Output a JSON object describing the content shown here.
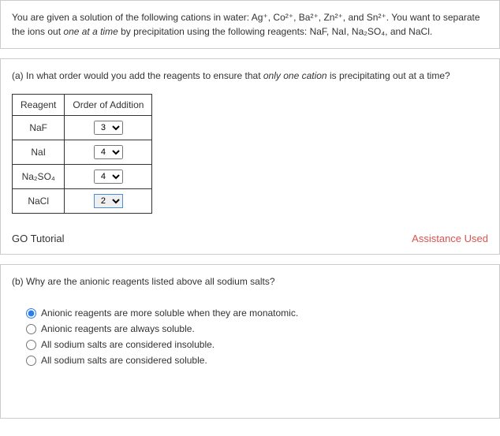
{
  "intro": {
    "prefix": "You are given a solution of the following cations in water: Ag⁺, Co²⁺, Ba²⁺, Zn²⁺, and Sn²⁺. You want to separate the ions out ",
    "italic1": "one at a time",
    "mid": " by precipitation using the following reagents: NaF, NaI, Na₂SO₄, and NaCl."
  },
  "partA": {
    "question_prefix": "(a) In what order would you add the reagents to ensure that ",
    "question_italic": "only one cation",
    "question_suffix": " is precipitating out at a time?",
    "headers": {
      "col1": "Reagent",
      "col2": "Order of Addition"
    },
    "rows": [
      {
        "reagent": "NaF",
        "value": "3"
      },
      {
        "reagent": "NaI",
        "value": "4"
      },
      {
        "reagent": "Na₂SO₄",
        "value": "4"
      },
      {
        "reagent": "NaCl",
        "value": "2"
      }
    ],
    "go_tutorial": "GO Tutorial",
    "assistance": "Assistance Used"
  },
  "partB": {
    "question": "(b) Why are the anionic reagents listed above all sodium salts?",
    "options": [
      "Anionic reagents are more soluble when they are monatomic.",
      "Anionic reagents are always soluble.",
      "All sodium salts are considered insoluble.",
      "All sodium salts are considered soluble."
    ],
    "selected": 0
  }
}
